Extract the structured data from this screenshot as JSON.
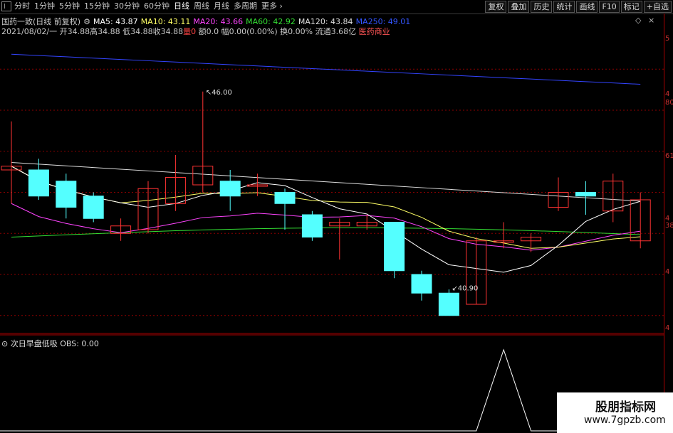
{
  "toolbar": {
    "periods": [
      "分时",
      "1分钟",
      "5分钟",
      "15分钟",
      "30分钟",
      "60分钟",
      "日线",
      "周线",
      "月线",
      "多周期",
      "更多"
    ],
    "active_period": "日线",
    "buttons": [
      "复权",
      "叠加",
      "历史",
      "统计",
      "画线",
      "F10",
      "标记",
      "+自选"
    ]
  },
  "header": {
    "name": "国药一致(日线 前复权)",
    "ma_labels": [
      {
        "text": "MA5: 43.87",
        "color": "#ffffff"
      },
      {
        "text": "MA10: 43.11",
        "color": "#ffff66"
      },
      {
        "text": "MA20: 43.66",
        "color": "#ff44ff"
      },
      {
        "text": "MA60: 42.92",
        "color": "#33dd33"
      },
      {
        "text": "MA120: 43.84",
        "color": "#dddddd"
      },
      {
        "text": "MA250: 49.01",
        "color": "#3355ff"
      }
    ]
  },
  "quote": {
    "date": "2021/08/02/一",
    "open": "开34.88",
    "high": "高34.88",
    "low": "低34.88",
    "close": "收34.88",
    "vol": "量0",
    "amount": "额0.0",
    "change": "幅0.00(0.00%)",
    "turnover": "换0.00%",
    "float": "流通3.68亿",
    "sector": "医药商业"
  },
  "annotations": {
    "high": "46.00",
    "low": "40.90"
  },
  "axis_labels": [
    "5",
    "4",
    "80",
    "61",
    "4",
    "38",
    "4",
    "4"
  ],
  "indicator": {
    "name": "次日早盘低吸",
    "value": "OBS: 0.00"
  },
  "watermark": {
    "line1": "股朋指标网",
    "line2": "www.7gpzb.com"
  },
  "colors": {
    "up": "#ff3333",
    "down": "#54ffff",
    "grid": "#8b0000"
  },
  "chart_data": {
    "type": "candlestick",
    "candles": [
      {
        "o": 43.9,
        "c": 44.0,
        "h": 45.2,
        "l": 43.0
      },
      {
        "o": 43.9,
        "c": 43.2,
        "h": 44.2,
        "l": 43.1
      },
      {
        "o": 43.6,
        "c": 42.9,
        "h": 43.8,
        "l": 42.6
      },
      {
        "o": 43.2,
        "c": 42.6,
        "h": 43.3,
        "l": 42.5
      },
      {
        "o": 42.2,
        "c": 42.4,
        "h": 42.6,
        "l": 42.0
      },
      {
        "o": 42.3,
        "c": 43.4,
        "h": 43.6,
        "l": 42.2
      },
      {
        "o": 43.0,
        "c": 43.7,
        "h": 44.3,
        "l": 42.8
      },
      {
        "o": 43.5,
        "c": 44.0,
        "h": 46.0,
        "l": 43.3
      },
      {
        "o": 43.6,
        "c": 43.2,
        "h": 43.9,
        "l": 42.8
      },
      {
        "o": 43.5,
        "c": 43.5,
        "h": 43.8,
        "l": 43.2
      },
      {
        "o": 43.3,
        "c": 43.0,
        "h": 43.4,
        "l": 42.3
      },
      {
        "o": 42.7,
        "c": 42.1,
        "h": 42.8,
        "l": 42.0
      },
      {
        "o": 42.4,
        "c": 42.5,
        "h": 42.6,
        "l": 41.5
      },
      {
        "o": 42.4,
        "c": 42.5,
        "h": 42.7,
        "l": 42.3
      },
      {
        "o": 42.5,
        "c": 41.2,
        "h": 42.5,
        "l": 41.0
      },
      {
        "o": 41.1,
        "c": 40.6,
        "h": 41.2,
        "l": 40.4
      },
      {
        "o": 40.6,
        "c": 40.0,
        "h": 40.7,
        "l": 40.9
      },
      {
        "o": 40.3,
        "c": 42.0,
        "h": 42.1,
        "l": 40.3
      },
      {
        "o": 42.0,
        "c": 42.0,
        "h": 42.5,
        "l": 41.8
      },
      {
        "o": 42.0,
        "c": 42.1,
        "h": 42.2,
        "l": 41.7
      },
      {
        "o": 42.9,
        "c": 43.3,
        "h": 43.7,
        "l": 42.8
      },
      {
        "o": 43.3,
        "c": 43.2,
        "h": 43.6,
        "l": 42.7
      },
      {
        "o": 42.8,
        "c": 43.6,
        "h": 43.8,
        "l": 42.5
      },
      {
        "o": 42.0,
        "c": 43.1,
        "h": 43.3,
        "l": 41.8
      }
    ],
    "ylim": [
      39.5,
      47.5
    ],
    "obs_signal_index": 18,
    "obs_signal_value": 1
  }
}
